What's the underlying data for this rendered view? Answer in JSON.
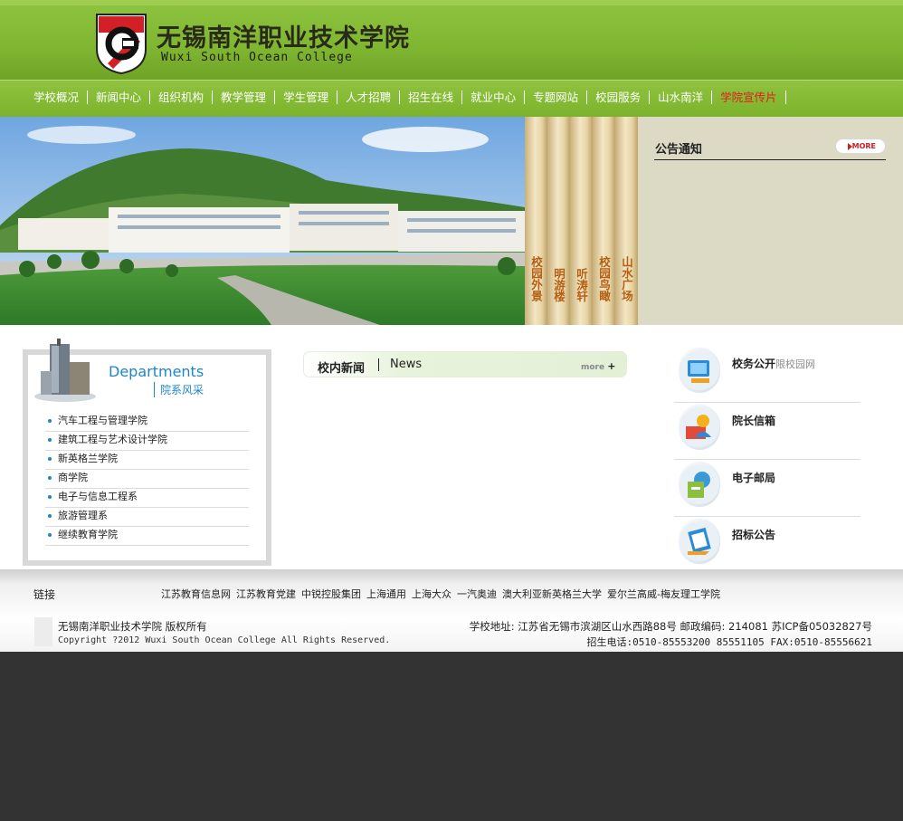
{
  "header": {
    "college_cn": "无锡南洋职业技术学院",
    "college_en": "Wuxi South Ocean College",
    "colors": {
      "green": "#7fb631",
      "logo_red": "#d31f26"
    }
  },
  "nav": {
    "items": [
      "学校概况",
      "新闻中心",
      "组织机构",
      "教学管理",
      "学生管理",
      "人才招聘",
      "招生在线",
      "就业中心",
      "专题网站",
      "校园服务",
      "山水南洋",
      "学院宣传片"
    ],
    "active_color": "#e31b1b"
  },
  "tabs": [
    "校园外景",
    "明游楼",
    "听涛轩",
    "校园鸟瞰",
    "山水广场"
  ],
  "notice": {
    "title": "公告通知",
    "more": "MORE"
  },
  "departments": {
    "title_en": "Departments",
    "title_cn": "院系风采",
    "items": [
      "汽车工程与管理学院",
      "建筑工程与艺术设计学院",
      "新英格兰学院",
      "商学院",
      "电子与信息工程系",
      "旅游管理系",
      "继续教育学院"
    ]
  },
  "news": {
    "title": "校内新闻",
    "title_en": "News",
    "more": "more"
  },
  "quick_links": [
    {
      "label": "校务公开",
      "sub": "限校园网",
      "icon": "monitor-icon"
    },
    {
      "label": "院长信箱",
      "sub": "",
      "icon": "user-mail-icon"
    },
    {
      "label": "电子邮局",
      "sub": "",
      "icon": "mailbox-icon"
    },
    {
      "label": "招标公告",
      "sub": "",
      "icon": "document-icon"
    }
  ],
  "footer": {
    "links_label": "链接",
    "links": [
      "江苏教育信息网",
      "江苏教育党建",
      "中锐控股集团",
      "上海通用",
      "上海大众",
      "一汽奥迪",
      "澳大利亚新英格兰大学",
      "爱尔兰高威-梅友理工学院"
    ],
    "copyright_cn": "无锡南洋职业技术学院 版权所有",
    "copyright_en": "Copyright ?2012 Wuxi South Ocean College All Rights Reserved.",
    "address": "学校地址: 江苏省无锡市滨湖区山水西路88号 邮政编码: 214081 苏ICP备05032827号",
    "phone": "招生电话:0510-85553200 85551105 FAX:0510-85556621"
  }
}
